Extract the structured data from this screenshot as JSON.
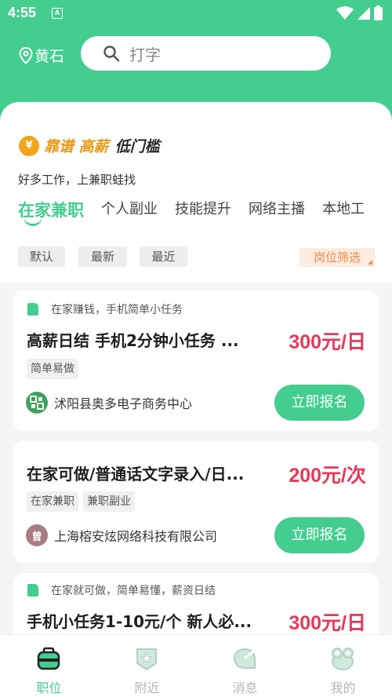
{
  "status_bar": {
    "time": "4:55",
    "notification_badge": "A"
  },
  "header": {
    "location": "黄石",
    "search_placeholder": "打字"
  },
  "slogan": {
    "coin": "¥",
    "highlight": "靠谱 高薪",
    "rest": "低门槛"
  },
  "subtitle": "好多工作，上兼职蛙找",
  "tabs": [
    {
      "label": "在家兼职",
      "active": true
    },
    {
      "label": "个人副业"
    },
    {
      "label": "技能提升"
    },
    {
      "label": "网络主播"
    },
    {
      "label": "本地工"
    }
  ],
  "filters": {
    "sort": [
      "默认",
      "最新",
      "最近"
    ],
    "position_filter": "岗位筛选"
  },
  "jobs": [
    {
      "tag": "在家赚钱，手机简单小任务",
      "title": "高薪日结 手机2分钟小任务 ...",
      "salary": "300元/日",
      "labels": [
        "简单易做"
      ],
      "company": "沭阳县奥多电子商务中心",
      "apply": "立即报名"
    },
    {
      "tag": "",
      "title": "在家可做/普通话文字录入/日...",
      "salary": "200元/次",
      "labels": [
        "在家兼职",
        "兼职副业"
      ],
      "company": "上海榕安炫网络科技有限公司",
      "avatar_text": "曾",
      "apply": "立即报名"
    },
    {
      "tag": "在家就可做，简单易懂，薪资日结",
      "title": "手机小任务1-10元/个 新人必...",
      "salary": "300元/日"
    }
  ],
  "bottom_nav": [
    {
      "label": "职位",
      "icon": "briefcase-icon",
      "active": true
    },
    {
      "label": "附近",
      "icon": "nearby-badge-icon"
    },
    {
      "label": "消息",
      "icon": "message-icon"
    },
    {
      "label": "我的",
      "icon": "frog-face-icon"
    }
  ],
  "colors": {
    "brand": "#43cd8f",
    "salary": "#e6395a",
    "accent_orange": "#f08b4a"
  }
}
